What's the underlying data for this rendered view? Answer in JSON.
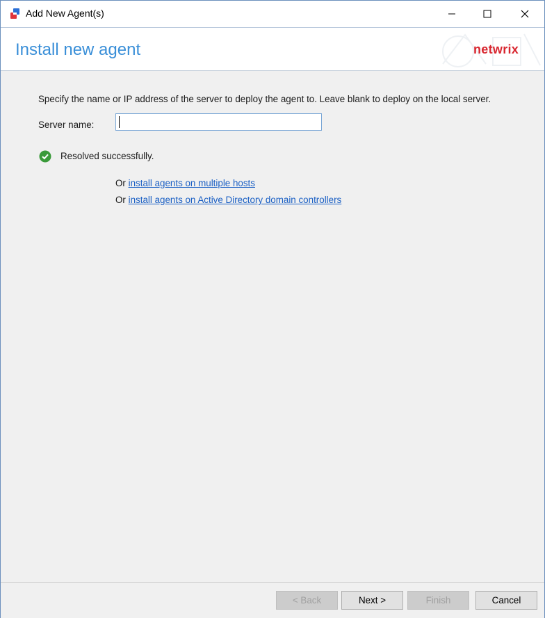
{
  "window": {
    "title": "Add New Agent(s)"
  },
  "header": {
    "title": "Install new agent",
    "brand": "netwrix"
  },
  "content": {
    "instruction": "Specify the name or IP address of the server to deploy the agent to. Leave blank to deploy on the local server.",
    "server_label": "Server name:",
    "server_value": "",
    "status_text": "Resolved successfully.",
    "links": [
      {
        "prefix": "Or ",
        "text": "install agents on multiple hosts"
      },
      {
        "prefix": "Or ",
        "text": "install agents on Active Directory domain controllers"
      }
    ]
  },
  "footer": {
    "back_label": "< Back",
    "next_label": "Next >",
    "finish_label": "Finish",
    "cancel_label": "Cancel"
  },
  "colors": {
    "accent": "#3a8fd8",
    "brand": "#d8262f",
    "link": "#1a5fc4",
    "success": "#3a9a3a"
  }
}
